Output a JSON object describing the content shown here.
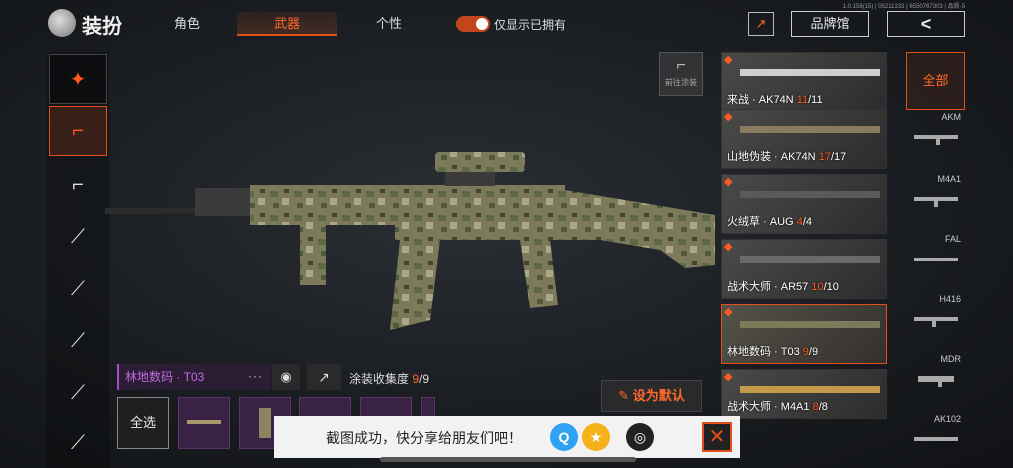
{
  "header": {
    "title": "装扮",
    "version": "1.0.158(15) | 05211333 | 6550767303 | 品质-5",
    "tabs": [
      {
        "label": "角色",
        "active": false
      },
      {
        "label": "武器",
        "active": true
      },
      {
        "label": "个性",
        "active": false
      }
    ],
    "toggle_label": "仅显示已拥有",
    "toggle_on": true,
    "brand_label": "品牌馆",
    "back_icon": "chevron-left-icon"
  },
  "categories": [
    {
      "icon": "gun-badge-icon"
    },
    {
      "icon": "assault-rifle-icon"
    },
    {
      "icon": "smg-icon"
    },
    {
      "icon": "shotgun-icon"
    },
    {
      "icon": "sniper-rifle-icon"
    },
    {
      "icon": "marksman-rifle-icon"
    },
    {
      "icon": "rifle-icon"
    },
    {
      "icon": "lmg-icon"
    }
  ],
  "paint_button": {
    "label": "前往涂装"
  },
  "selected_skin": {
    "name": "林地数码 · T03",
    "collection_label": "涂装收集度",
    "collection_owned": "9",
    "collection_total": "/9"
  },
  "actions": {
    "set_default": "设为默认",
    "select_all": "全选"
  },
  "skin_list": [
    {
      "name": "来战 · AK74N",
      "owned": "11",
      "total": "/11",
      "selected": false
    },
    {
      "name": "山地伪装 · AK74N",
      "owned": "17",
      "total": "/17",
      "selected": false
    },
    {
      "name": "火绒草 · AUG",
      "owned": "4",
      "total": "/4",
      "selected": false
    },
    {
      "name": "战术大师 · AR57",
      "owned": "10",
      "total": "/10",
      "selected": false
    },
    {
      "name": "林地数码 · T03",
      "owned": "9",
      "total": "/9",
      "selected": true
    },
    {
      "name": "战术大师 · M4A1",
      "owned": "8",
      "total": "/8",
      "selected": false
    }
  ],
  "weapon_filter": {
    "all_label": "全部",
    "weapons": [
      "AKM",
      "M4A1",
      "FAL",
      "H416",
      "MDR",
      "AK102"
    ]
  },
  "toast": {
    "message": "截图成功，快分享给朋友们吧！",
    "share_targets": [
      "qq-icon",
      "qzone-icon",
      "wechat-moments-icon"
    ]
  }
}
